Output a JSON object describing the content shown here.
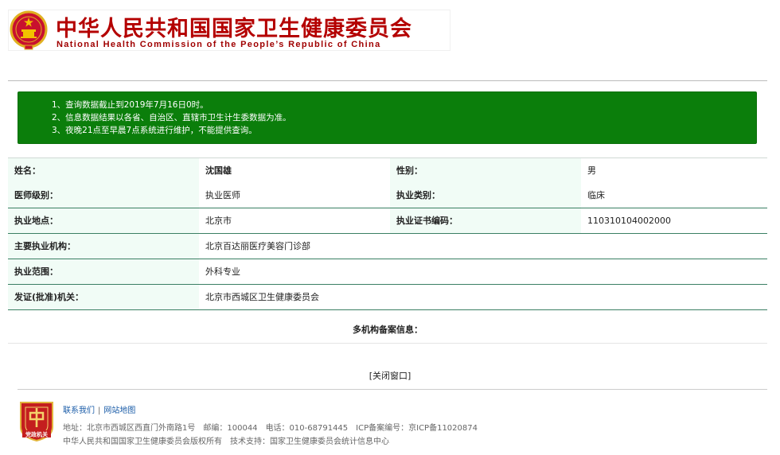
{
  "header": {
    "title_cn": "中华人民共和国国家卫生健康委员会",
    "title_en": "National Health Commission of the People’s Republic of China"
  },
  "notice": [
    "1、查询数据截止到2019年7月16日0时。",
    "2、信息数据结果以各省、自治区、直辖市卫生计生委数据为准。",
    "3、夜晚21点至早晨7点系统进行维护，不能提供查询。"
  ],
  "info": {
    "name_label": "姓名：",
    "name_value": "沈国雄",
    "gender_label": "性别：",
    "gender_value": "男",
    "level_label": "医师级别：",
    "level_value": "执业医师",
    "category_label": "执业类别：",
    "category_value": "临床",
    "location_label": "执业地点：",
    "location_value": "北京市",
    "cert_label": "执业证书编码：",
    "cert_value": "110310104002000",
    "institution_label": "主要执业机构：",
    "institution_value": "北京百达丽医疗美容门诊部",
    "scope_label": "执业范围：",
    "scope_value": "外科专业",
    "issuer_label": "发证(批准)机关：",
    "issuer_value": "北京市西城区卫生健康委员会"
  },
  "multi_label": "多机构备案信息：",
  "close_label": "[关闭窗口]",
  "footer": {
    "link_contact": "联系我们",
    "separator": "|",
    "link_sitemap": "网站地图",
    "address": "地址：北京市西城区西直门外南路1号",
    "postcode": "邮编：100044",
    "phone": "电话：010-68791445",
    "icp": "ICP备案编号：京ICP备11020874",
    "copyright": "中华人民共和国国家卫生健康委员会版权所有",
    "support": "技术支持：国家卫生健康委员会统计信息中心",
    "badge_text": "党政机关"
  },
  "colors": {
    "brand_red": "#b40000",
    "notice_green": "#0b7e0b",
    "row_border": "#3a7f63",
    "label_bg": "#f1fcf6"
  },
  "icons": {
    "emblem": "national-emblem-icon",
    "badge": "party-government-badge-icon"
  }
}
